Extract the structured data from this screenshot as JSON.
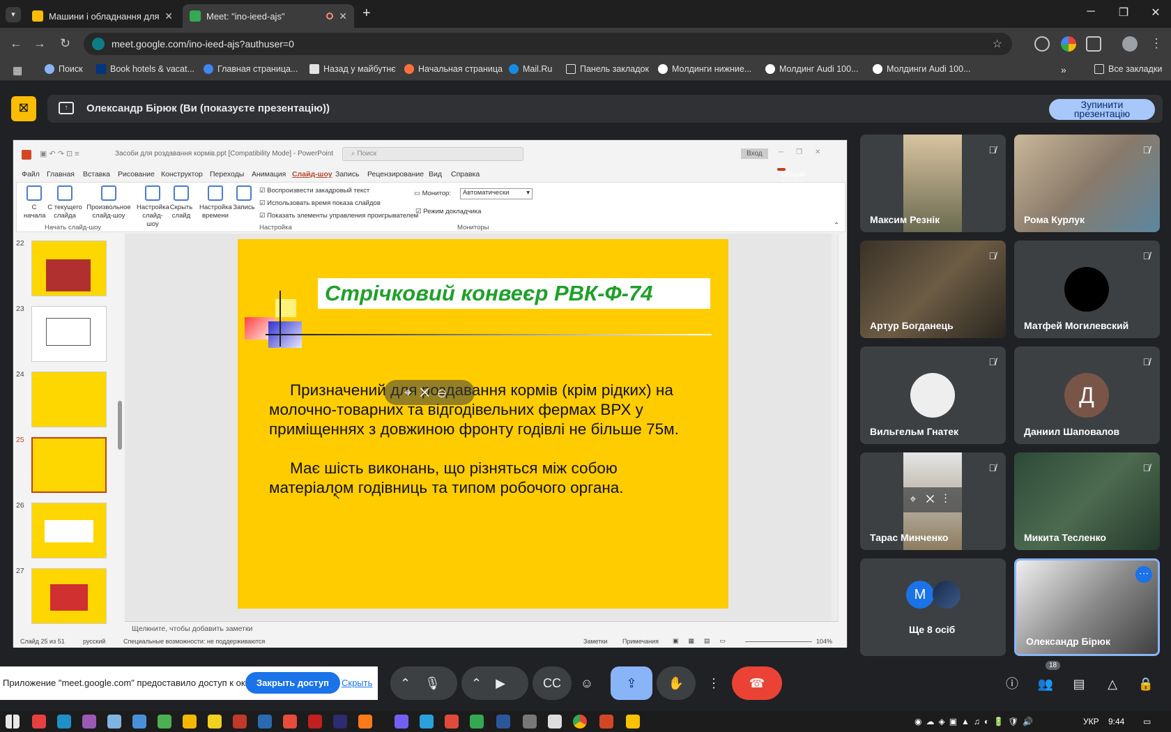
{
  "browser": {
    "tabs": [
      {
        "title": "Машини і обладнання для тва",
        "favicon_color": "#fbbc04",
        "active": false
      },
      {
        "title": "Meet: \"ino-ieed-ajs\"",
        "favicon_color": "#34a853",
        "active": true
      }
    ],
    "new_tab_label": "+",
    "url": "meet.google.com/ino-ieed-ajs?authuser=0",
    "bookmarks": [
      "Поиск",
      "Book hotels & vacat...",
      "Главная страница...",
      "Назад у майбутнє",
      "Начальная страница",
      "Mail.Ru",
      "Панель закладок",
      "Молдинги нижние...",
      "Молдинг Audi 100...",
      "Молдинги Audi 100..."
    ],
    "all_bookmarks": "Все закладки"
  },
  "meet": {
    "presenter_banner": "Олександр Бірюк (Ви (показуєте презентацію))",
    "stop_button_line1": "Зупинити",
    "stop_button_line2": "презентацію",
    "participants": [
      {
        "name": "Максим Резнік",
        "type": "video"
      },
      {
        "name": "Рома Курлук",
        "type": "video"
      },
      {
        "name": "Артур Богданець",
        "type": "video"
      },
      {
        "name": "Матфей Могилевский",
        "type": "video"
      },
      {
        "name": "Вильгельм Гнатек",
        "type": "avatar"
      },
      {
        "name": "Даниил Шаповалов",
        "type": "letter",
        "letter": "Д"
      },
      {
        "name": "Тарас Минченко",
        "type": "video"
      },
      {
        "name": "Микита Тесленко",
        "type": "video"
      },
      {
        "name": "Ще 8 осіб",
        "type": "more",
        "letter": "М"
      },
      {
        "name": "Олександр Бірюк",
        "type": "video"
      }
    ],
    "participant_count": "18",
    "share_notice": "Приложение \"meet.google.com\" предоставило доступ к окну.",
    "close_access": "Закрыть доступ",
    "hide": "Скрыть"
  },
  "powerpoint": {
    "title": "Засоби для роздавання кормів.ppt [Compatibility Mode] - PowerPoint",
    "search_placeholder": "Поиск",
    "login": "Вход",
    "share": "Общий доступ",
    "tabs": [
      "Файл",
      "Главная",
      "Вставка",
      "Рисование",
      "Конструктор",
      "Переходы",
      "Анимация",
      "Слайд-шоу",
      "Запись",
      "Рецензирование",
      "Вид",
      "Справка"
    ],
    "ribbon": {
      "from_start": "С начала",
      "from_current": "С текущего слайда",
      "custom": "Произвольное слайд-шоу",
      "group_start": "Начать слайд-шоу",
      "setup": "Настройка слайд-шоу",
      "hide_slide": "Скрыть слайд",
      "rehearse": "Настройка времени",
      "record": "Запись",
      "cb1": "Воспроизвести закадровый текст",
      "cb2": "Использовать время показа слайдов",
      "cb3": "Показать элементы управления проигрывателем",
      "group_setup": "Настройка",
      "monitor_label": "Монитор:",
      "monitor_value": "Автоматически",
      "presenter_view": "Режим докладчика",
      "group_monitors": "Мониторы"
    },
    "thumb_numbers": [
      "22",
      "23",
      "24",
      "25",
      "26",
      "27"
    ],
    "slide": {
      "title": "Стрічковий  конвеєр РВК-Ф-74",
      "p1_line1": "Призначений для роздавання кормів (крім рідких) на",
      "p1_line2": "молочно-товарних та відгодівельних фермах ВРХ у",
      "p1_line3": "приміщеннях з довжиною фронту годівлі не більше 75м.",
      "p2_line1": "Має шість виконань, що різняться між собою",
      "p2_line2": "матеріалом годівниць та типом робочого органа."
    },
    "notes_placeholder": "Щелкните, чтобы добавить заметки",
    "status": {
      "slide": "Слайд 25 из 51",
      "lang": "русский",
      "accessibility": "Специальные возможности: не поддерживаются",
      "notes": "Заметки",
      "comments": "Примечания",
      "zoom": "104%"
    }
  },
  "taskbar": {
    "lang": "УКР",
    "time": "9:44"
  }
}
